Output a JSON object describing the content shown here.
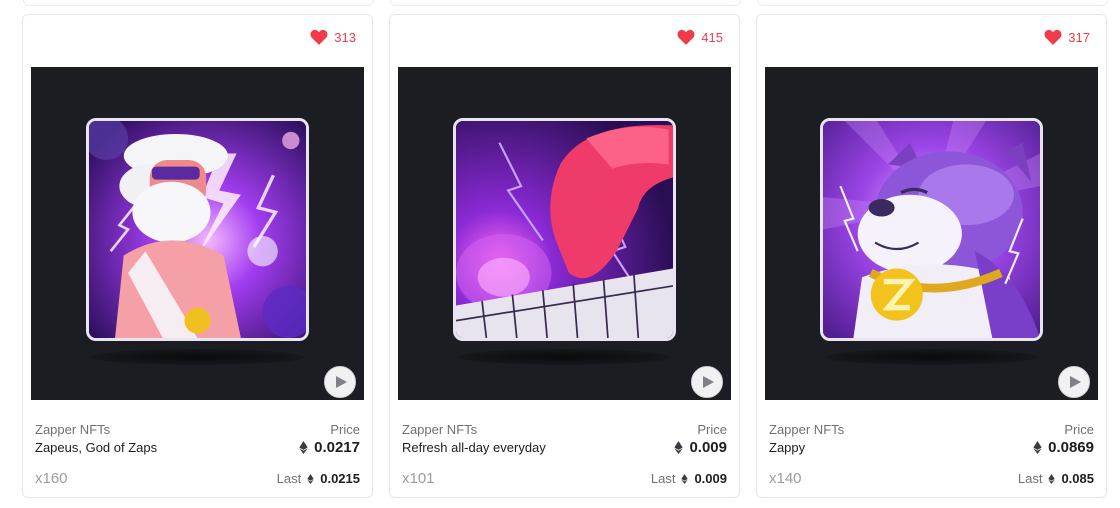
{
  "cards": [
    {
      "likes": "313",
      "collection": "Zapper NFTs",
      "name": "Zapeus, God of Zaps",
      "price_label": "Price",
      "price": "0.0217",
      "quantity": "x160",
      "last_label": "Last",
      "last_price": "0.0215",
      "art": "zeus-lightning-character"
    },
    {
      "likes": "415",
      "collection": "Zapper NFTs",
      "name": "Refresh all-day everyday",
      "price_label": "Price",
      "price": "0.009",
      "quantity": "x101",
      "last_label": "Last",
      "last_price": "0.009",
      "art": "hand-pressing-keyboard"
    },
    {
      "likes": "317",
      "collection": "Zapper NFTs",
      "name": "Zappy",
      "price_label": "Price",
      "price": "0.0869",
      "quantity": "x140",
      "last_label": "Last",
      "last_price": "0.085",
      "art": "purple-dog-gold-chain"
    }
  ],
  "icons": {
    "like": "heart-icon",
    "currency": "ethereum-icon",
    "media": "play-icon"
  },
  "colors": {
    "like": "#ef3b4a",
    "media_bg": "#1c1d22",
    "art_purple": "#8a2be2"
  }
}
